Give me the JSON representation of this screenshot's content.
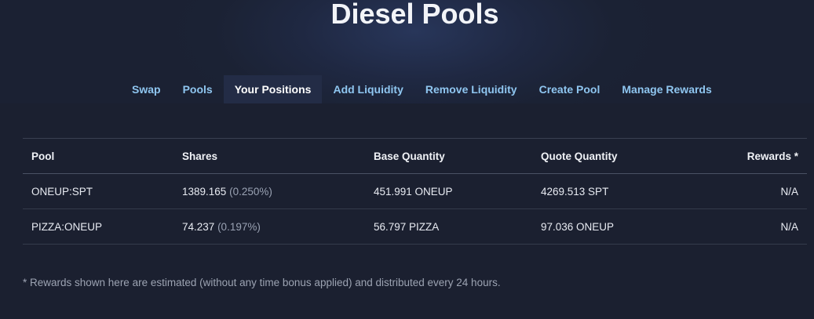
{
  "header": {
    "title": "Diesel Pools"
  },
  "tabs": [
    {
      "label": "Swap",
      "active": false
    },
    {
      "label": "Pools",
      "active": false
    },
    {
      "label": "Your Positions",
      "active": true
    },
    {
      "label": "Add Liquidity",
      "active": false
    },
    {
      "label": "Remove Liquidity",
      "active": false
    },
    {
      "label": "Create Pool",
      "active": false
    },
    {
      "label": "Manage Rewards",
      "active": false
    }
  ],
  "table": {
    "headers": {
      "pool": "Pool",
      "shares": "Shares",
      "base": "Base Quantity",
      "quote": "Quote Quantity",
      "rewards": "Rewards *"
    },
    "rows": [
      {
        "pool": "ONEUP:SPT",
        "shares": "1389.165",
        "share_pct": "(0.250%)",
        "base": "451.991 ONEUP",
        "quote": "4269.513 SPT",
        "rewards": "N/A"
      },
      {
        "pool": "PIZZA:ONEUP",
        "shares": "74.237",
        "share_pct": "(0.197%)",
        "base": "56.797 PIZZA",
        "quote": "97.036 ONEUP",
        "rewards": "N/A"
      }
    ]
  },
  "footnote": "* Rewards shown here are estimated (without any time bonus applied) and distributed every 24 hours.",
  "colors": {
    "background": "#1b2030",
    "tab_link": "#8fc6f0",
    "tab_active_bg": "#232c46"
  }
}
